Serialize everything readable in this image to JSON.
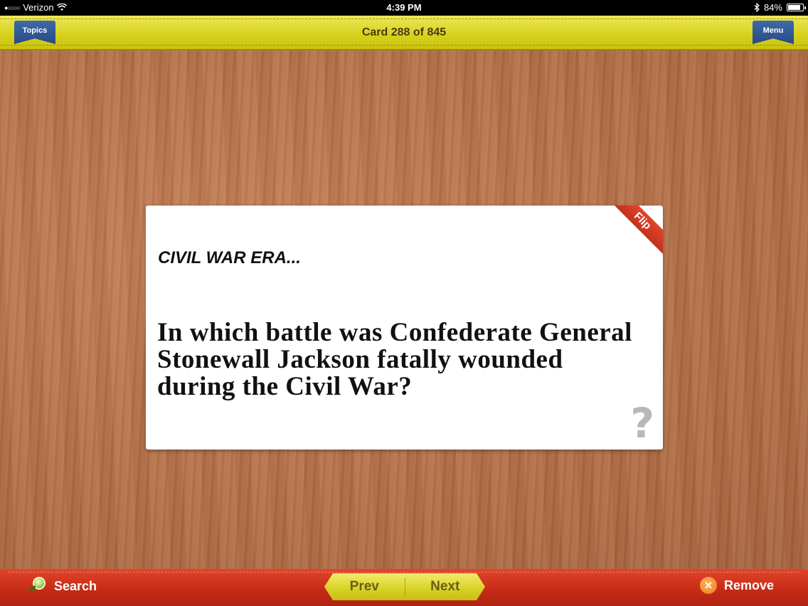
{
  "status_bar": {
    "carrier": "Verizon",
    "time": "4:39 PM",
    "battery_percent": "84%",
    "battery_level": 0.84
  },
  "top_bar": {
    "topics_label": "Topics",
    "card_counter": "Card 288 of 845",
    "menu_label": "Menu"
  },
  "card": {
    "category": "CIVIL WAR ERA...",
    "question": "In which battle was Confederate General Stonewall Jackson fatally wounded during the Civil War?",
    "flip_label": "Flip",
    "help_glyph": "?"
  },
  "bottom_bar": {
    "search_label": "Search",
    "prev_label": "Prev",
    "next_label": "Next",
    "remove_label": "Remove"
  },
  "icons": {
    "search": "magnifier-icon",
    "remove": "remove-icon",
    "help": "question-mark-icon",
    "wifi": "wifi-icon",
    "bluetooth": "bluetooth-icon",
    "battery": "battery-icon"
  },
  "colors": {
    "top_bar": "#d8d21f",
    "bottom_bar": "#c42a16",
    "bookmark": "#264a86",
    "flip_ribbon": "#c5301c",
    "wood": "#b5714a"
  }
}
